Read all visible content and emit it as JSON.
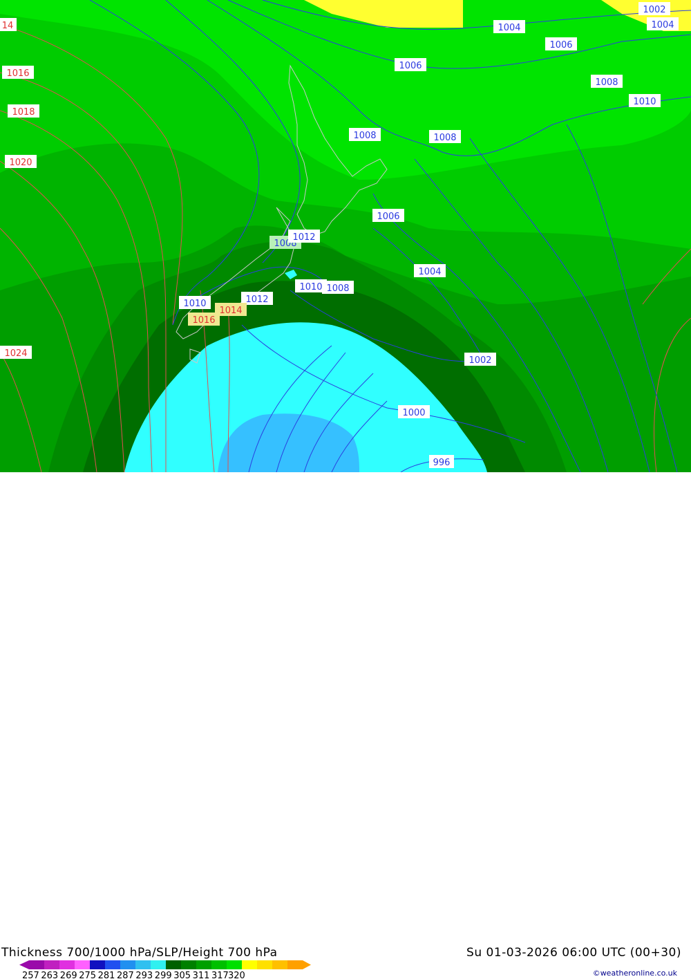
{
  "title": "Thickness 700/1000 hPa/SLP/Height 700 hPa",
  "datetime": "Su 01-03-2026 06:00 UTC (00+30)",
  "credit": "©weatheronline.co.uk",
  "colorbar": {
    "labels": [
      "257",
      "263",
      "269",
      "275",
      "281",
      "287",
      "293",
      "299",
      "305",
      "311",
      "317",
      "320"
    ],
    "colors": [
      "#9a0aaa",
      "#c020c0",
      "#e030e0",
      "#ff60ff",
      "#1010c0",
      "#2050f0",
      "#2090f0",
      "#30c0f0",
      "#30f0f0",
      "#006000",
      "#008000",
      "#00a000",
      "#00c000",
      "#00e000",
      "#ffff00",
      "#ffe000",
      "#ffc000",
      "#ffa000"
    ]
  },
  "isobars_blue": [
    "1002",
    "1004",
    "1004",
    "1006",
    "1006",
    "1008",
    "1010",
    "1008",
    "1008",
    "1006",
    "1008",
    "1012",
    "1004",
    "1010",
    "1008",
    "1010",
    "1012",
    "1002",
    "1000",
    "996"
  ],
  "isobars_red": [
    "14",
    "1016",
    "1018",
    "1020",
    "1024",
    "1014",
    "1016"
  ]
}
